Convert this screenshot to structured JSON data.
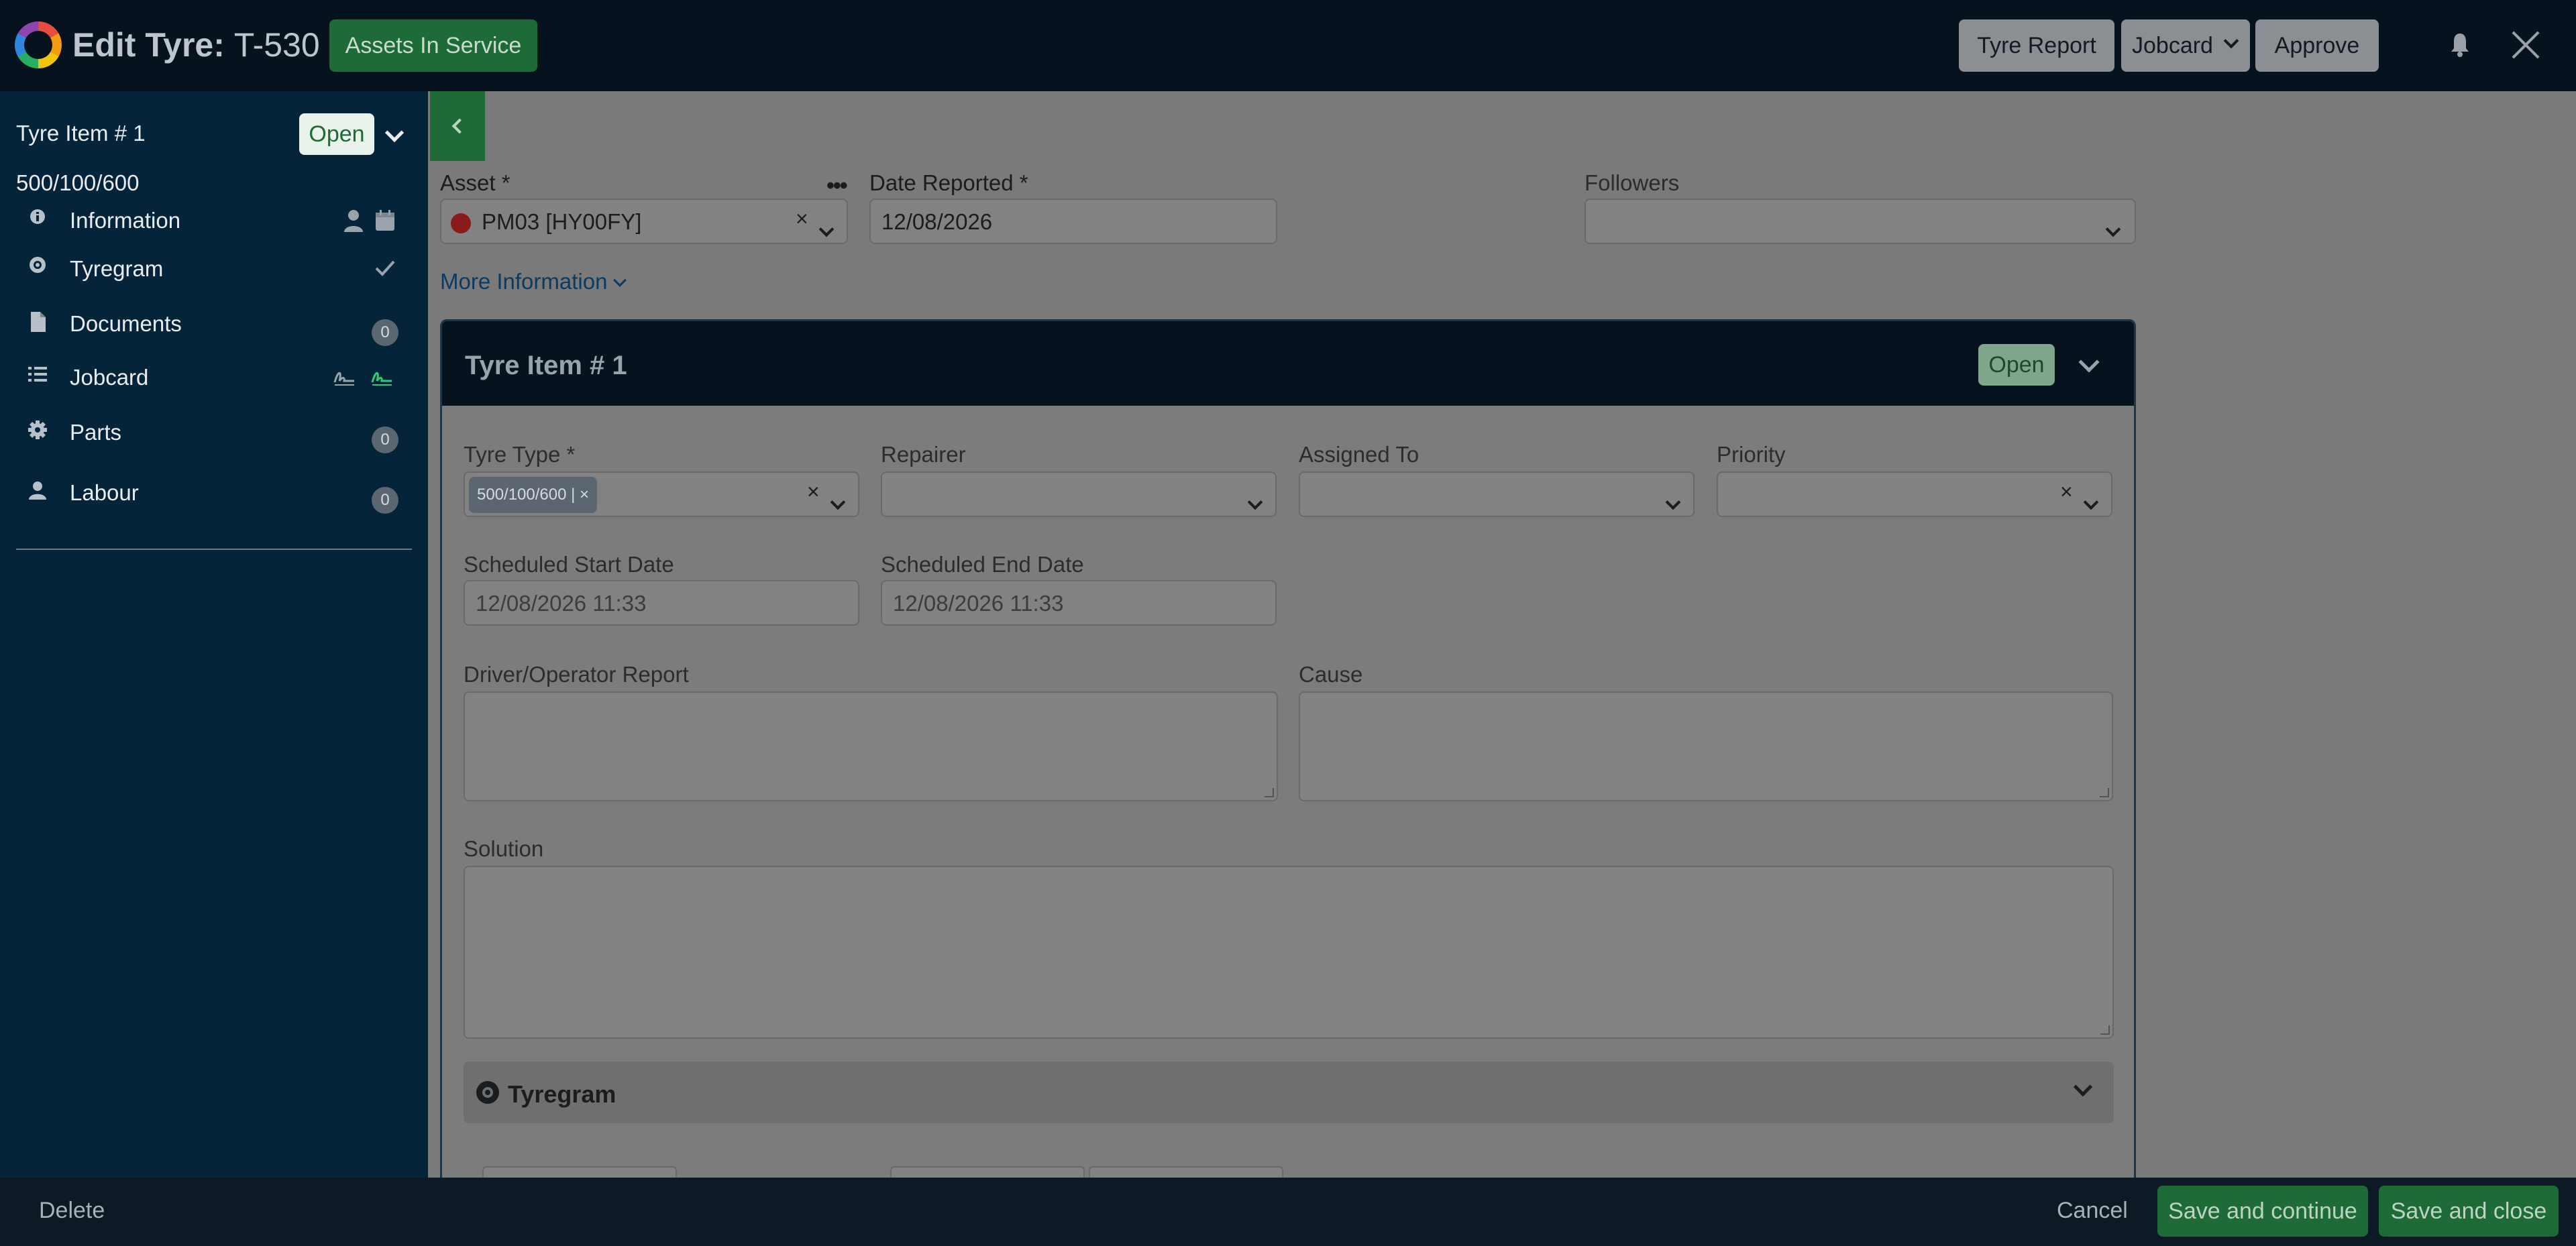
{
  "header": {
    "title_prefix": "Edit Tyre:",
    "record_id": "T-530",
    "status_button": "Assets In Service",
    "actions": {
      "tyre_report": "Tyre Report",
      "jobcard": "Jobcard",
      "approve": "Approve"
    }
  },
  "sidebar": {
    "item_title": "Tyre Item # 1",
    "status": "Open",
    "tyre_size": "500/100/600",
    "nav": [
      {
        "label": "Information",
        "icon": "info-icon"
      },
      {
        "label": "Tyregram",
        "icon": "tyre-icon"
      },
      {
        "label": "Documents",
        "icon": "document-icon",
        "count": "0"
      },
      {
        "label": "Jobcard",
        "icon": "list-icon"
      },
      {
        "label": "Parts",
        "icon": "gear-icon",
        "count": "0"
      },
      {
        "label": "Labour",
        "icon": "person-icon",
        "count": "0"
      }
    ]
  },
  "form": {
    "asset_label": "Asset *",
    "asset_value": "PM03 [HY00FY]",
    "date_reported_label": "Date Reported *",
    "date_reported_value": "12/08/2026",
    "followers_label": "Followers",
    "followers_value": "",
    "more_information": "More Information"
  },
  "card": {
    "title": "Tyre Item # 1",
    "status": "Open",
    "tyre_type_label": "Tyre Type *",
    "tyre_type_chip": "500/100/600 | ×",
    "repairer_label": "Repairer",
    "assigned_to_label": "Assigned To",
    "priority_label": "Priority",
    "sched_start_label": "Scheduled Start Date",
    "sched_start_value": "12/08/2026 11:33",
    "sched_end_label": "Scheduled End Date",
    "sched_end_value": "12/08/2026 11:33",
    "driver_report_label": "Driver/Operator Report",
    "cause_label": "Cause",
    "solution_label": "Solution",
    "tyregram_section": "Tyregram"
  },
  "footer": {
    "delete": "Delete",
    "cancel": "Cancel",
    "save_continue": "Save and continue",
    "save_close": "Save and close"
  }
}
